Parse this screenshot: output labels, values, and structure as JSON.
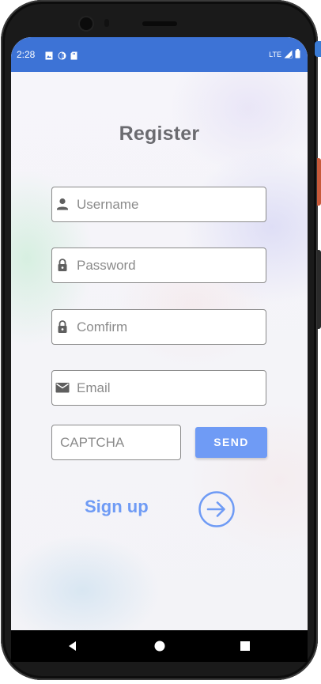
{
  "status_bar": {
    "time": "2:28",
    "network": "LTE",
    "color": "#3d73d6"
  },
  "register": {
    "title": "Register",
    "username_placeholder": "Username",
    "password_placeholder": "Password",
    "confirm_placeholder": "Comfirm",
    "email_placeholder": "Email",
    "captcha_placeholder": "CAPTCHA",
    "send_label": "SEND",
    "signup_label": "Sign up"
  },
  "icons": {
    "username": "person-icon",
    "password": "lock-icon",
    "confirm": "lock-icon",
    "email": "mail-icon",
    "signup": "arrow-right-circle-icon",
    "nav_back": "back-triangle-icon",
    "nav_home": "home-circle-icon",
    "nav_recents": "recents-square-icon"
  },
  "colors": {
    "accent": "#6f9bf5",
    "title": "#6b6b70"
  }
}
